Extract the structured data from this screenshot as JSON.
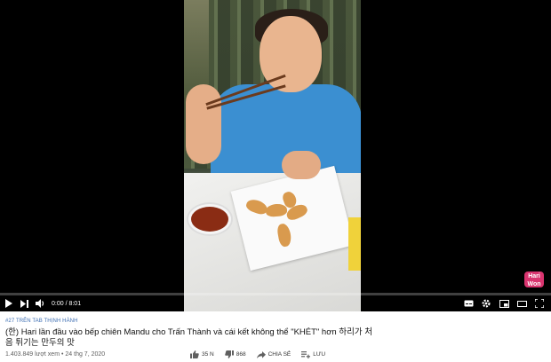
{
  "player": {
    "time_display": "0:00 / 8:01",
    "progress": 0,
    "watermark": "Hari Won",
    "controls": {
      "play": "play-icon",
      "next": "next-icon",
      "volume": "volume-icon",
      "subtitles": "subtitles-icon",
      "settings": "gear-icon",
      "miniplayer": "miniplayer-icon",
      "theater": "theater-icon",
      "fullscreen": "fullscreen-icon"
    }
  },
  "video_info": {
    "hashtag": "#27 TRÊN TAB THỊNH HÀNH",
    "title": "(한) Hari lần đầu vào bếp chiên Mandu cho Trấn Thành và cái kết không thể \"KHÉT\" hơn 하리가 처음 튀기는 만두의 맛",
    "views": "1.403.849 lượt xem",
    "date": "24 thg 7, 2020",
    "separator": "•"
  },
  "actions": {
    "like_count": "35 N",
    "dislike_count": "868",
    "share_label": "CHIA SẺ",
    "save_label": "LƯU"
  },
  "colors": {
    "accent": "#ff0000",
    "hashtag": "#3e6fb3",
    "meta": "#606060"
  }
}
